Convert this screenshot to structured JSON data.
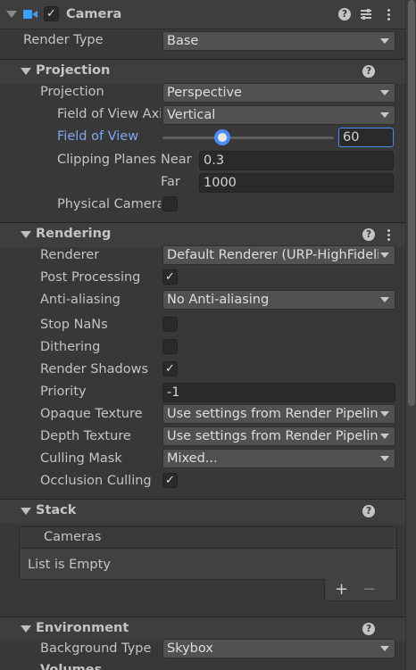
{
  "component": {
    "title": "Camera",
    "enabled": true,
    "icon": "camera-icon"
  },
  "render_type": {
    "label": "Render Type",
    "value": "Base"
  },
  "projection": {
    "title": "Projection",
    "projection": {
      "label": "Projection",
      "value": "Perspective"
    },
    "fov_axis": {
      "label": "Field of View Axis",
      "value": "Vertical"
    },
    "fov": {
      "label": "Field of View",
      "value": "60",
      "slider_fraction": 0.39
    },
    "clipping": {
      "label": "Clipping Planes",
      "near_label": "Near",
      "near": "0.3",
      "far_label": "Far",
      "far": "1000"
    },
    "physical": {
      "label": "Physical Camera",
      "checked": false
    }
  },
  "rendering": {
    "title": "Rendering",
    "renderer": {
      "label": "Renderer",
      "value": "Default Renderer (URP-HighFidelity)"
    },
    "post_processing": {
      "label": "Post Processing",
      "checked": true
    },
    "anti_aliasing": {
      "label": "Anti-aliasing",
      "value": "No Anti-aliasing"
    },
    "stop_nans": {
      "label": "Stop NaNs",
      "checked": false
    },
    "dithering": {
      "label": "Dithering",
      "checked": false
    },
    "render_shadows": {
      "label": "Render Shadows",
      "checked": true
    },
    "priority": {
      "label": "Priority",
      "value": "-1"
    },
    "opaque_texture": {
      "label": "Opaque Texture",
      "value": "Use settings from Render Pipeline Asset"
    },
    "depth_texture": {
      "label": "Depth Texture",
      "value": "Use settings from Render Pipeline Asset"
    },
    "culling_mask": {
      "label": "Culling Mask",
      "value": "Mixed..."
    },
    "occlusion_culling": {
      "label": "Occlusion Culling",
      "checked": true
    }
  },
  "stack": {
    "title": "Stack",
    "list_header": "Cameras",
    "empty_text": "List is Empty",
    "add": "+",
    "remove": "−"
  },
  "environment": {
    "title": "Environment",
    "background_type": {
      "label": "Background Type",
      "value": "Skybox"
    },
    "volumes_label": "Volumes"
  },
  "icons": {
    "help": "?",
    "check": "✓"
  },
  "colors": {
    "accent_blue": "#4c8bf5",
    "label_active": "#7fa8ee"
  }
}
